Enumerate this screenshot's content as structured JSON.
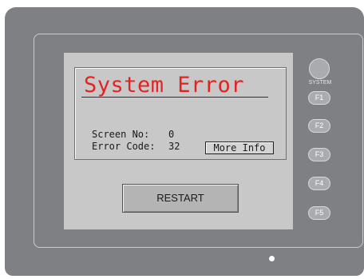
{
  "error_screen": {
    "title": "System Error",
    "screen_no_label": "Screen No:",
    "screen_no_value": "0",
    "error_code_label": "Error Code:",
    "error_code_value": "32",
    "more_info_label": "More Info",
    "restart_label": "RESTART"
  },
  "panel": {
    "system_label": "SYSTEM",
    "function_keys": [
      "F1",
      "F2",
      "F3",
      "F4",
      "F5"
    ]
  },
  "colors": {
    "title_text": "#e52222",
    "screen_background": "#c8c8c8",
    "bezel": "#7e8084"
  },
  "icons": {
    "system_button": "system-button-icon",
    "status_led": "status-led-icon"
  }
}
